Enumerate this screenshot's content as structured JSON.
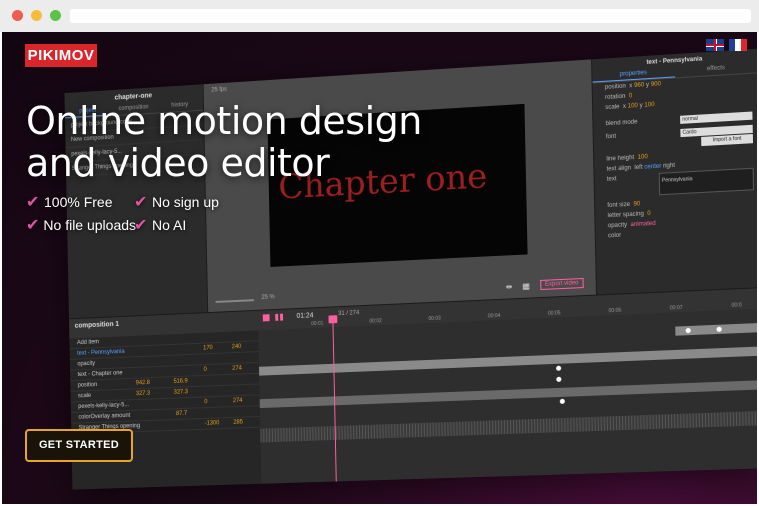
{
  "site": {
    "logo_text": "PIKIMOV",
    "headline_line1": "Online motion design",
    "headline_line2": "and video editor",
    "features": [
      "100% Free",
      "No sign up",
      "No file uploads",
      "No AI"
    ],
    "cta_label": "GET STARTED",
    "colors": {
      "brand": "#d8262b",
      "accent": "#e054a6",
      "cta_border": "#e8a524"
    }
  },
  "editor": {
    "left_panel": {
      "title": "chapter-one",
      "tabs": [
        "project",
        "composition",
        "history"
      ],
      "rows": [
        "project background color",
        "New composition",
        "pexels-kelly-lacy-5...",
        "Stranger Things opening"
      ]
    },
    "canvas": {
      "fps": "25 fps",
      "stage_text": "Chapter one",
      "zoom": "25 %",
      "export_label": "Export video"
    },
    "right_panel": {
      "title": "text - Pennsylvania",
      "tabs": [
        "properties",
        "effects"
      ],
      "position_label": "position",
      "position_x": "960",
      "position_y": "900",
      "rotation_label": "rotation",
      "rotation_val": "0",
      "scale_label": "scale",
      "scale_x": "100",
      "scale_y": "100",
      "blend_label": "blend mode",
      "blend_val": "normal",
      "font_label": "font",
      "font_val": "Cardo",
      "import_font": "Import a font",
      "line_height_label": "line height",
      "line_height_val": "100",
      "text_align_label": "text align",
      "align_left": "left",
      "align_center": "center",
      "align_right": "right",
      "text_label": "text",
      "text_val": "Pennsylvania",
      "font_size_label": "font size",
      "font_size_val": "90",
      "letter_spacing_label": "letter spacing",
      "letter_spacing_val": "0",
      "opacity_label": "opacity",
      "opacity_val": "animated",
      "color_label": "color"
    },
    "timeline": {
      "composition": "composition 1",
      "time": "01:24",
      "frame": "31 / 274",
      "ruler": [
        "00:01",
        "00:02",
        "00:03",
        "00:04",
        "00:05",
        "00:06",
        "00:07",
        "00:0"
      ],
      "layers": [
        {
          "label": "Add item",
          "v1": "",
          "v2": ""
        },
        {
          "label": "text - Pennsylvania",
          "v1": "170",
          "v2": "240"
        },
        {
          "label": "opacity",
          "v1": "",
          "v2": ""
        },
        {
          "label": "text - Chapter one",
          "v1": "0",
          "v2": "274"
        },
        {
          "label": "position",
          "v1": "942.8",
          "v2": "516.9"
        },
        {
          "label": "scale",
          "v1": "327.3",
          "v2": "327.3"
        },
        {
          "label": "pexels-kelly-lacy-5...",
          "v1": "0",
          "v2": "274"
        },
        {
          "label": "colorOverlay   amount",
          "v1": "87.7",
          "v2": ""
        },
        {
          "label": "Stranger Things opening",
          "v1": "-1300",
          "v2": "285"
        }
      ]
    }
  }
}
